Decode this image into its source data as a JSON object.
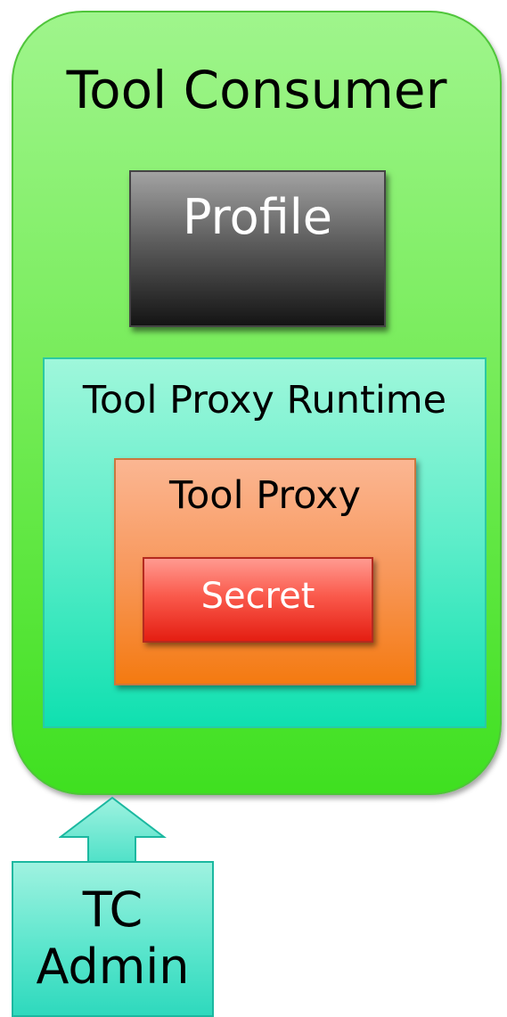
{
  "diagram": {
    "consumer": {
      "title": "Tool Consumer",
      "color": "#78ec5b"
    },
    "profile": {
      "label": "Profile",
      "color": "#5e5e5e"
    },
    "runtime": {
      "label": "Tool Proxy Runtime",
      "color": "#5cedc9"
    },
    "proxy": {
      "label": "Tool Proxy",
      "color": "#f8985c"
    },
    "secret": {
      "label": "Secret",
      "color": "#fa5a4c"
    },
    "admin": {
      "line1": "TC",
      "line2": "Admin",
      "color": "#5ce6cd"
    },
    "arrow": {
      "icon": "up-arrow-icon",
      "direction": "up"
    }
  }
}
